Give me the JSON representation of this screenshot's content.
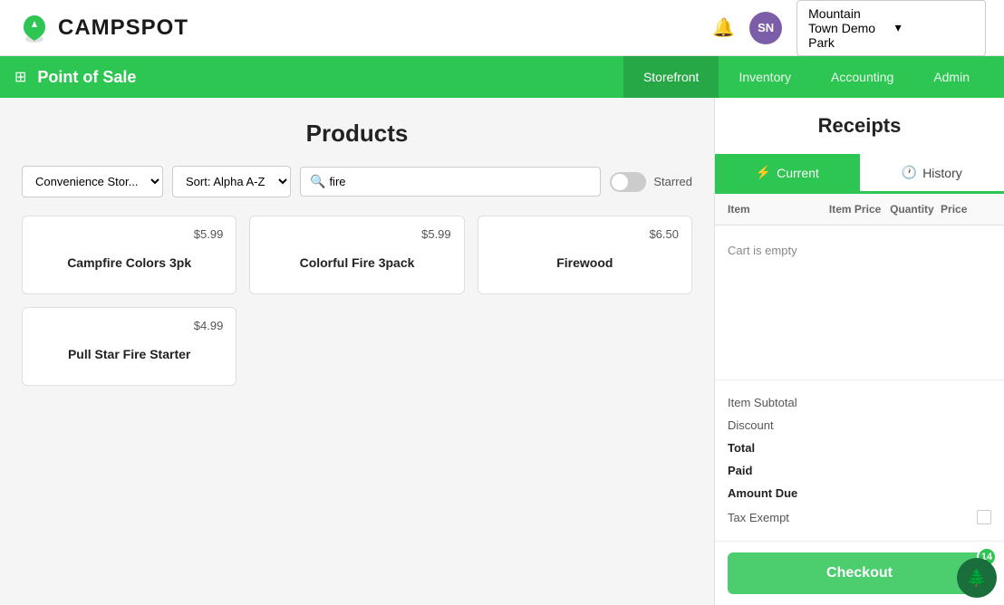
{
  "topNav": {
    "logoText": "CAMPSPOT",
    "bellLabel": "notifications",
    "avatarInitials": "SN",
    "parkSelector": {
      "label": "Mountain Town Demo Park",
      "chevron": "▾"
    }
  },
  "secNav": {
    "title": "Point of Sale",
    "links": [
      {
        "id": "storefront",
        "label": "Storefront",
        "active": true
      },
      {
        "id": "inventory",
        "label": "Inventory",
        "active": false
      },
      {
        "id": "accounting",
        "label": "Accounting",
        "active": false
      },
      {
        "id": "admin",
        "label": "Admin",
        "active": false
      }
    ]
  },
  "products": {
    "title": "Products",
    "categoryDefault": "Convenience Stor...",
    "sortDefault": "Sort: Alpha A-Z",
    "searchValue": "fire",
    "searchPlaceholder": "fire",
    "starredLabel": "Starred",
    "items": [
      {
        "id": 1,
        "name": "Campfire Colors 3pk",
        "price": "$5.99"
      },
      {
        "id": 2,
        "name": "Colorful Fire 3pack",
        "price": "$5.99"
      },
      {
        "id": 3,
        "name": "Firewood",
        "price": "$6.50"
      },
      {
        "id": 4,
        "name": "Pull Star Fire Starter",
        "price": "$4.99"
      }
    ]
  },
  "receipts": {
    "title": "Receipts",
    "tabs": [
      {
        "id": "current",
        "label": "Current",
        "active": true,
        "icon": "⚡"
      },
      {
        "id": "history",
        "label": "History",
        "active": false,
        "icon": "🕐"
      }
    ],
    "tableHeaders": {
      "item": "Item",
      "itemPrice": "Item Price",
      "quantity": "Quantity",
      "price": "Price"
    },
    "cartEmpty": "Cart is empty",
    "totals": {
      "itemSubtotal": "Item Subtotal",
      "discount": "Discount",
      "total": "Total",
      "paid": "Paid",
      "amountDue": "Amount Due",
      "taxExempt": "Tax Exempt"
    },
    "checkoutLabel": "Checkout",
    "badgeCount": "14"
  }
}
